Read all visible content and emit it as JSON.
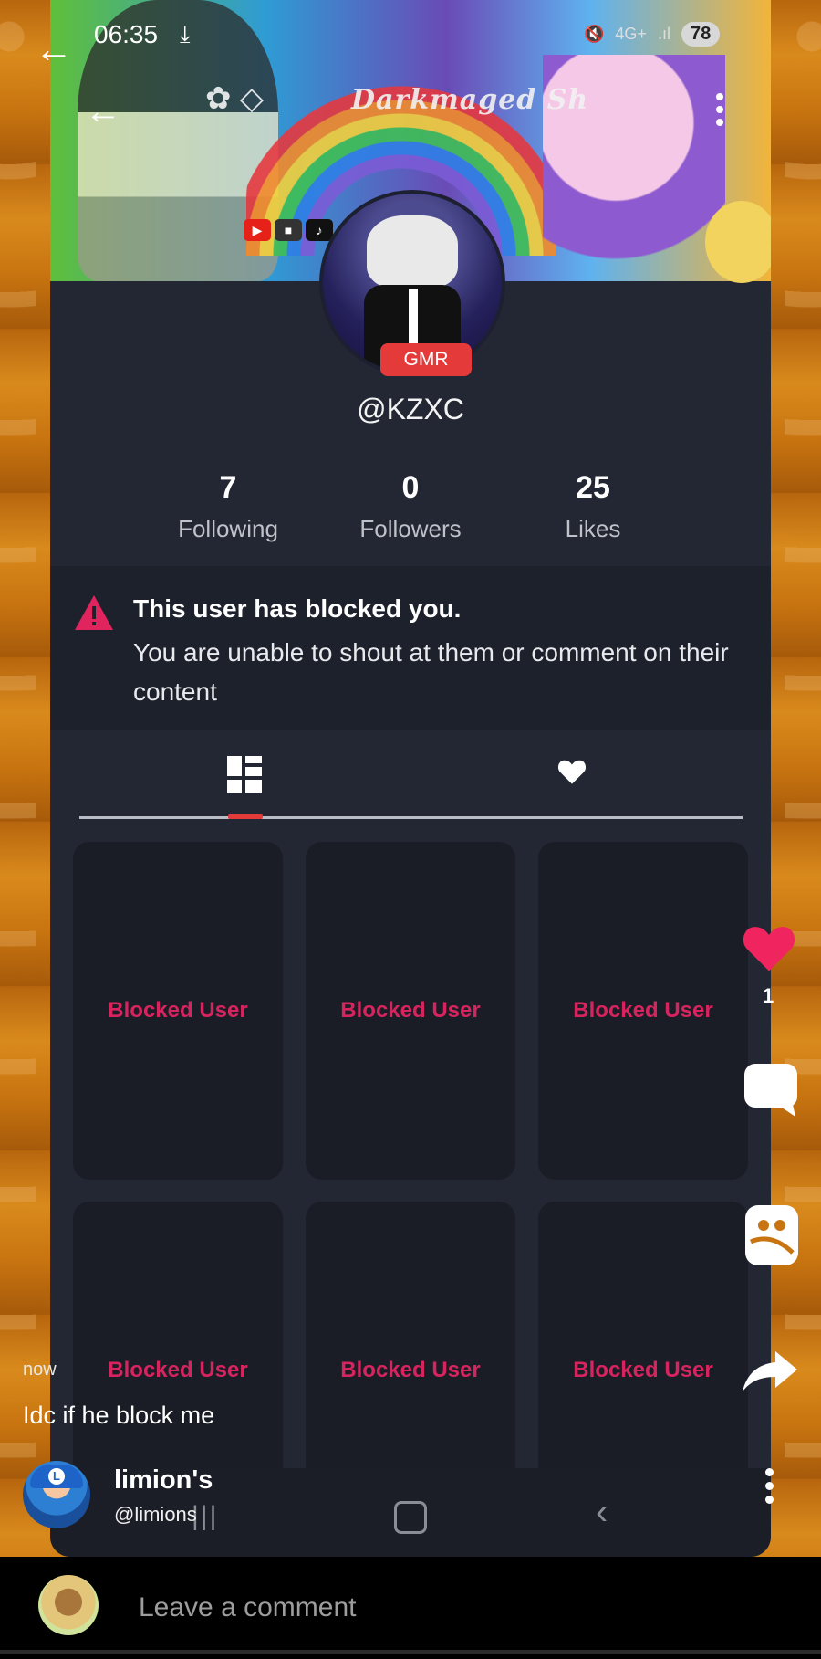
{
  "status_bar": {
    "time": "06:35",
    "network": "4G+",
    "battery": "78"
  },
  "profile": {
    "banner_title": "Darkmaged Sh",
    "badge": "GMR",
    "username": "@KZXC",
    "stats": [
      {
        "value": "7",
        "label": "Following"
      },
      {
        "value": "0",
        "label": "Followers"
      },
      {
        "value": "25",
        "label": "Likes"
      }
    ],
    "blocked_title": "This user has blocked you.",
    "blocked_message": "You are unable to shout at them or comment on their content",
    "grid_label": "Blocked User"
  },
  "post": {
    "likes": "1",
    "time": "now",
    "caption": "Idc if he block me",
    "author_name": "limion's",
    "author_handle": "@limions"
  },
  "comment": {
    "placeholder": "Leave a comment"
  },
  "colors": {
    "accent": "#e0245e",
    "badge": "#e43a3a",
    "panel": "#232733"
  }
}
